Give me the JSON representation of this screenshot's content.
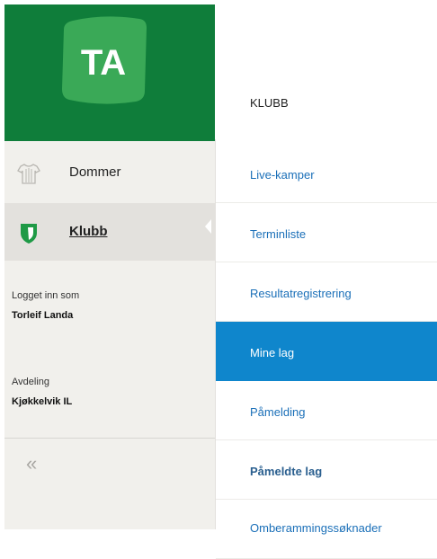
{
  "logo": {
    "text": "TA"
  },
  "colors": {
    "brand_green": "#0f7d3a",
    "logo_green": "#3aa957",
    "accent_blue": "#0f86cc",
    "link_blue": "#1a6fb8"
  },
  "sidebar": {
    "nav": [
      {
        "label": "Dommer",
        "icon": "jersey-icon"
      },
      {
        "label": "Klubb",
        "icon": "shield-icon",
        "active": true
      }
    ],
    "logged_in_label": "Logget inn som",
    "user_name": "Torleif Landa",
    "department_label": "Avdeling",
    "department_name": "Kjøkkelvik IL",
    "collapse_glyph": "«"
  },
  "main": {
    "title": "KLUBB",
    "menu": [
      {
        "label": "Live-kamper"
      },
      {
        "label": "Terminliste"
      },
      {
        "label": "Resultatregistrering"
      },
      {
        "label": "Mine lag",
        "active": true
      },
      {
        "label": "Påmelding"
      },
      {
        "label": "Påmeldte lag"
      },
      {
        "label": "Omberammingssøknader"
      }
    ]
  }
}
